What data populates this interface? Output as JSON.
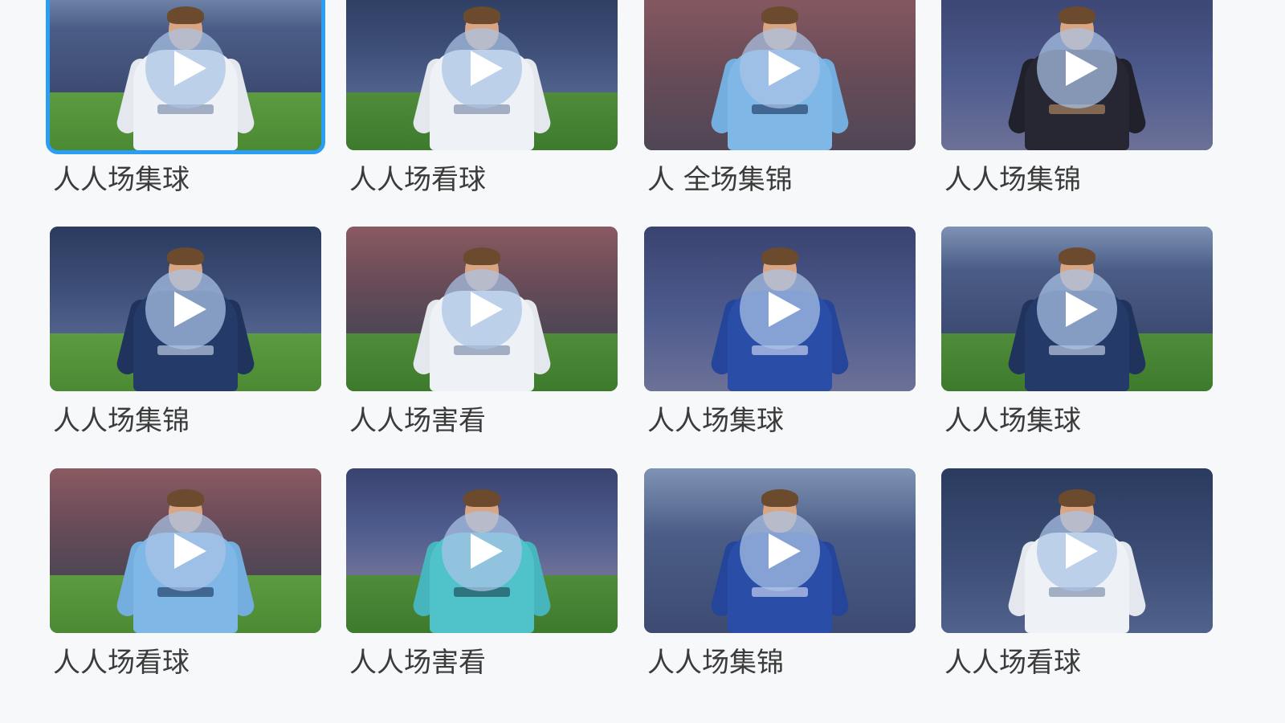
{
  "colors": {
    "selection_border": "#2a9df4",
    "background": "#f7f8fa",
    "play_overlay": "#aac3e6",
    "caption_text": "#3b3b3b"
  },
  "grid": {
    "columns": 4,
    "rows": 3,
    "items": [
      {
        "label": "人人场集球",
        "selected": true,
        "kit": "white",
        "icon": "play-icon"
      },
      {
        "label": "人人场看球",
        "selected": false,
        "kit": "white",
        "icon": "play-icon"
      },
      {
        "label": "人 全场集锦",
        "selected": false,
        "kit": "sky-blue",
        "icon": "play-icon"
      },
      {
        "label": "人人场集锦",
        "selected": false,
        "kit": "black",
        "icon": "play-icon"
      },
      {
        "label": "人人场集锦",
        "selected": false,
        "kit": "navy",
        "icon": "play-icon"
      },
      {
        "label": "人人场害看",
        "selected": false,
        "kit": "white",
        "icon": "play-icon"
      },
      {
        "label": "人人场集球",
        "selected": false,
        "kit": "royal-blue",
        "icon": "play-icon"
      },
      {
        "label": "人人场集球",
        "selected": false,
        "kit": "navy",
        "icon": "play-icon"
      },
      {
        "label": "人人场看球",
        "selected": false,
        "kit": "sky-blue",
        "icon": "play-icon"
      },
      {
        "label": "人人场害看",
        "selected": false,
        "kit": "teal",
        "icon": "play-icon"
      },
      {
        "label": "人人场集锦",
        "selected": false,
        "kit": "royal-blue",
        "icon": "play-icon"
      },
      {
        "label": "人人场看球",
        "selected": false,
        "kit": "white",
        "icon": "play-icon"
      }
    ]
  }
}
